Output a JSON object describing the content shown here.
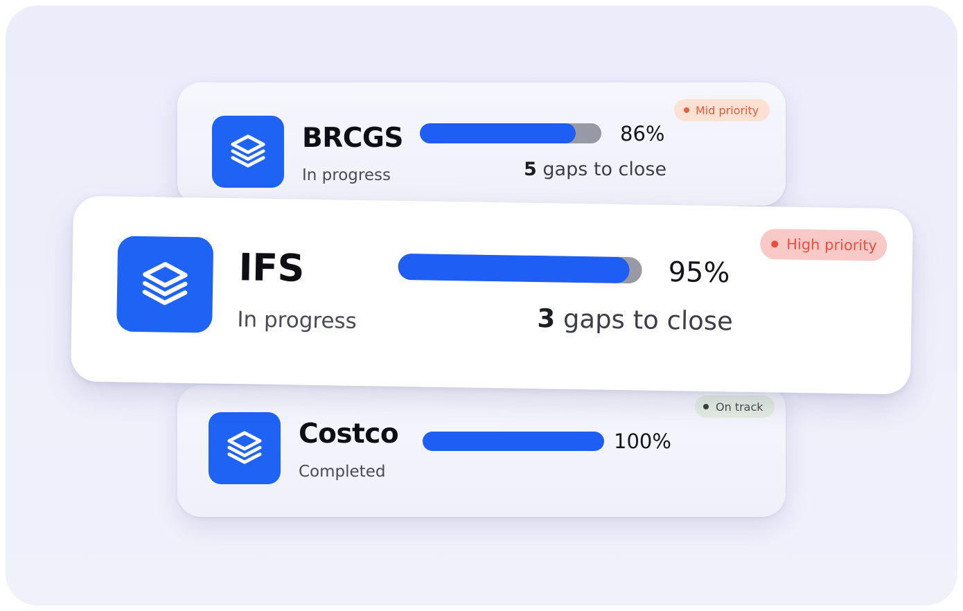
{
  "cards": [
    {
      "title": "BRCGS",
      "status": "In progress",
      "progress_percent": 86,
      "percent_label": "86%",
      "gaps_count": "5",
      "gaps_text": "gaps to close",
      "badge": {
        "label": "Mid priority",
        "bg_color": "#fde2d3",
        "dot_color": "#ee5a3c",
        "text_color": "#e8593d"
      },
      "icon": "layers-stack-icon"
    },
    {
      "title": "IFS",
      "status": "In progress",
      "progress_percent": 95,
      "percent_label": "95%",
      "gaps_count": "3",
      "gaps_text": "gaps to close",
      "badge": {
        "label": "High priority",
        "bg_color": "#f9c9c8",
        "dot_color": "#ee4a3a",
        "text_color": "#e8513f"
      },
      "icon": "layers-stack-icon"
    },
    {
      "title": "Costco",
      "status": "Completed",
      "progress_percent": 100,
      "percent_label": "100%",
      "badge": {
        "label": "On track",
        "bg_color": "#e4ede2",
        "dot_color": "#3c3c3c",
        "text_color": "#4a4a4a"
      },
      "icon": "layers-stack-icon"
    }
  ],
  "colors": {
    "accent": "#1f5ef5",
    "icon_bg": "#1f63f4",
    "track": "#979aa4",
    "background": "#ececfb"
  }
}
